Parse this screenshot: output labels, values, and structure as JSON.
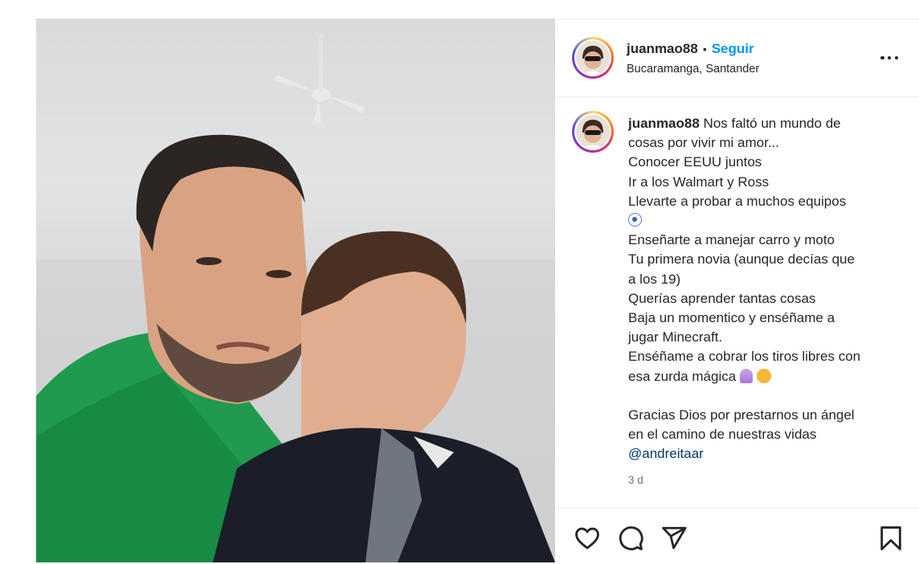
{
  "post": {
    "username": "juanmao88",
    "separator": "•",
    "follow_label": "Seguir",
    "location": "Bucaramanga, Santander",
    "image_alt": "Selfie de un hombre con camiseta verde y un niño que le da un beso en la mejilla"
  },
  "caption": {
    "username": "juanmao88",
    "lines": [
      "Nos faltó un mundo de",
      "cosas por vivir mi amor...",
      "Conocer EEUU juntos",
      "Ir a los Walmart y Ross",
      "Llevarte a probar a muchos equipos",
      "Enseñarte a manejar carro y moto",
      "Tu primera novia (aunque decías que",
      "a los 19)",
      "Querías aprender tantas cosas",
      "Baja un momentico y enséñame a",
      "jugar Minecraft.",
      "Enséñame a cobrar los tiros libres con",
      "esa zurda mágica",
      "Gracias Dios por prestarnos un ángel",
      "en el camino de nuestras vidas"
    ],
    "mention": "@andreitaar",
    "emoji": [
      "soccer-ball",
      "praying-hands",
      "disappointed-face"
    ],
    "timestamp": "3 d"
  },
  "actions": {
    "icons": [
      "heart-icon",
      "comment-icon",
      "share-icon",
      "bookmark-icon"
    ]
  },
  "colors": {
    "follow": "#0095f6",
    "mention": "#00376b",
    "text": "#262626",
    "muted": "#737373"
  }
}
